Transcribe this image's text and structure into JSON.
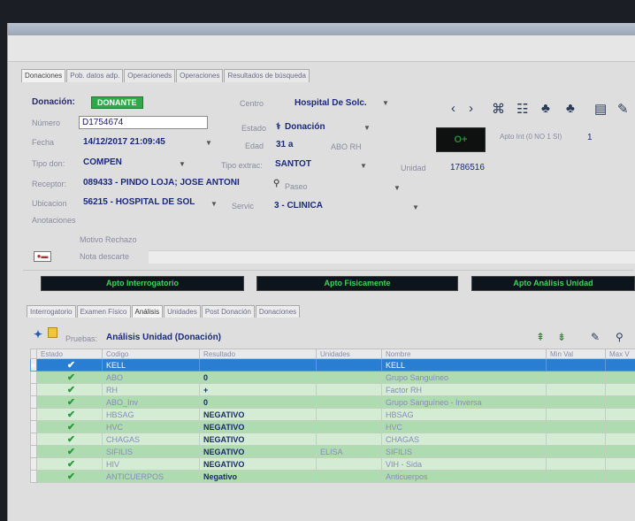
{
  "tabs": [
    {
      "label": "Donaciones",
      "active": true
    },
    {
      "label": "Pob. datos adp."
    },
    {
      "label": "Operacioneds"
    },
    {
      "label": "Operaciones"
    },
    {
      "label": "Resultados de búsqueda"
    }
  ],
  "form": {
    "donacion_label": "Donación:",
    "donante_badge": "DONANTE",
    "centro_label": "Centro",
    "centro_value": "Hospital De Solc.",
    "numero_label": "Número",
    "numero_value": "D1754674",
    "estado_label": "Estado",
    "estado_value": "Donación",
    "fecha_label": "Fecha",
    "fecha_value": "14/12/2017 21:09:45",
    "edad_label": "Edad",
    "edad_value": "31 a",
    "abo_label": "ABO RH",
    "tipo_don_label": "Tipo don:",
    "tipo_don_value": "COMPEN",
    "tipo_extrac_label": "Tipo extrac:",
    "tipo_extrac_value": "SANTOT",
    "unidad_label": "Unidad",
    "unidad_value": "1786516",
    "receptor_label": "Receptor:",
    "receptor_value": "089433 - PINDO  LOJA; JOSE ANTONI",
    "paseo_label": "Paseo",
    "ubicacion_label": "Ubicacion",
    "ubicacion_value": "56215 - HOSPITAL DE SOL",
    "servic_label": "Servic",
    "servic_value": "3 - CLINICA",
    "anotaciones_label": "Anotaciones",
    "motivo_label": "Motivo Rechazo",
    "nota_label": "Nota descarte",
    "black_box": "O+",
    "apto_label": "Apto Int (0 NO 1 SI)",
    "apto_value": "1"
  },
  "status_bars": [
    "Apto Interrogatorio",
    "Apto Físicamente",
    "Apto Análisis Unidad"
  ],
  "subtabs": [
    {
      "label": "Interrogatorio"
    },
    {
      "label": "Examen Físico"
    },
    {
      "label": "Análisis",
      "active": true
    },
    {
      "label": "Unidades"
    },
    {
      "label": "Post Donación"
    },
    {
      "label": "Donaciones"
    }
  ],
  "pruebas": {
    "label": "Pruebas:",
    "value": "Análisis Unidad (Donación)"
  },
  "table": {
    "headers": [
      "Estado",
      "Codigo",
      "Resultado",
      "Unidades",
      "Nombre",
      "Min Val",
      "Max V"
    ],
    "rows": [
      {
        "codigo": "KELL",
        "resultado": "",
        "unidades": "",
        "nombre": "KELL"
      },
      {
        "codigo": "ABO",
        "resultado": "0",
        "unidades": "",
        "nombre": "Grupo Sanguíneo"
      },
      {
        "codigo": "RH",
        "resultado": "+",
        "unidades": "",
        "nombre": "Factor RH"
      },
      {
        "codigo": "ABO_Inv",
        "resultado": "0",
        "unidades": "",
        "nombre": "Grupo Sanguíneo - Inversa"
      },
      {
        "codigo": "HBSAG",
        "resultado": "NEGATIVO",
        "unidades": "",
        "nombre": "HBSAG"
      },
      {
        "codigo": "HVC",
        "resultado": "NEGATIVO",
        "unidades": "",
        "nombre": "HVC"
      },
      {
        "codigo": "CHAGAS",
        "resultado": "NEGATIVO",
        "unidades": "",
        "nombre": "CHAGAS"
      },
      {
        "codigo": "SIFILIS",
        "resultado": "NEGATIVO",
        "unidades": "ELISA",
        "nombre": "SIFILIS"
      },
      {
        "codigo": "HIV",
        "resultado": "NEGATIVO",
        "unidades": "",
        "nombre": "VIH - Sida"
      },
      {
        "codigo": "ANTICUERPOS",
        "resultado": "Negativo",
        "unidades": "",
        "nombre": "Anticuerpos"
      }
    ]
  },
  "colors": {
    "accent": "#2a7ed2",
    "ok_green": "#2fa84a",
    "bar_text": "#3ad45a"
  }
}
